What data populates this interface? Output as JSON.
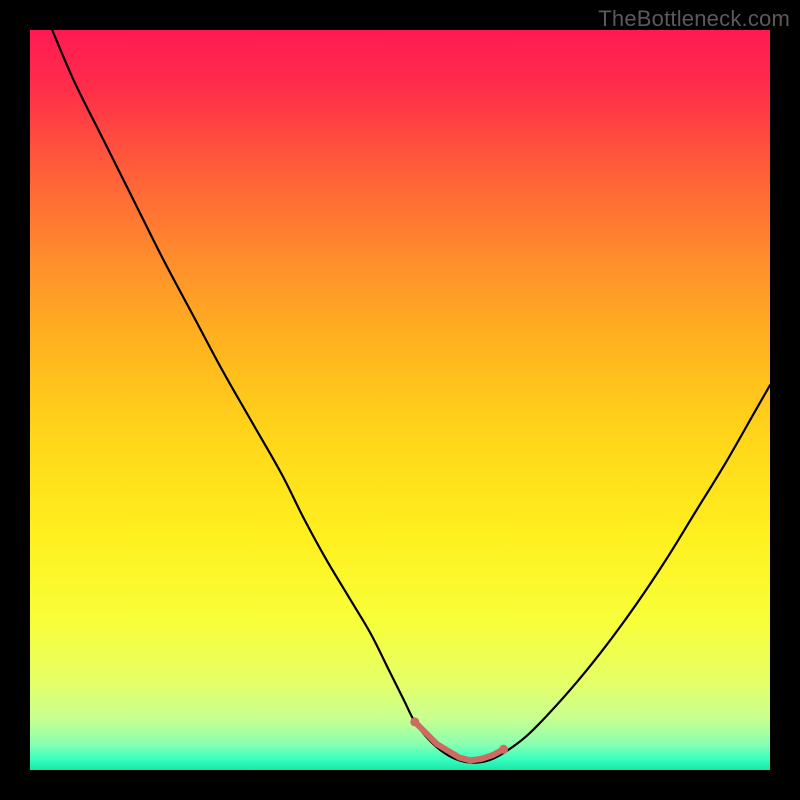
{
  "watermark": "TheBottleneck.com",
  "colors": {
    "page_bg": "#000000",
    "curve": "#000000",
    "marker": "#cf6a62"
  },
  "gradient_stops": [
    {
      "offset": 0.0,
      "color": "#ff1a53"
    },
    {
      "offset": 0.08,
      "color": "#ff2e4a"
    },
    {
      "offset": 0.18,
      "color": "#ff5a3a"
    },
    {
      "offset": 0.3,
      "color": "#ff8a2e"
    },
    {
      "offset": 0.42,
      "color": "#ffb21f"
    },
    {
      "offset": 0.55,
      "color": "#ffd61a"
    },
    {
      "offset": 0.68,
      "color": "#ffef1e"
    },
    {
      "offset": 0.8,
      "color": "#f8ff3a"
    },
    {
      "offset": 0.88,
      "color": "#e6ff66"
    },
    {
      "offset": 0.93,
      "color": "#c8ff90"
    },
    {
      "offset": 0.965,
      "color": "#8affb0"
    },
    {
      "offset": 0.985,
      "color": "#3affc0"
    },
    {
      "offset": 1.0,
      "color": "#18e6a8"
    }
  ],
  "chart_data": {
    "type": "line",
    "title": "",
    "xlabel": "",
    "ylabel": "",
    "xlim": [
      0,
      100
    ],
    "ylim": [
      0,
      100
    ],
    "series": [
      {
        "name": "bottleneck-curve",
        "x": [
          3,
          6,
          10,
          14,
          18,
          22,
          26,
          30,
          34,
          37,
          40,
          43,
          46,
          48.5,
          50.5,
          52,
          54,
          56,
          58,
          60,
          62,
          64,
          67,
          70,
          74,
          78,
          82,
          86,
          90,
          94,
          98,
          100
        ],
        "y": [
          100,
          93,
          85,
          77,
          69,
          61.5,
          54,
          47,
          40,
          34,
          28.5,
          23.5,
          18.5,
          13.5,
          9.5,
          6.5,
          4.0,
          2.3,
          1.3,
          1.0,
          1.3,
          2.3,
          4.5,
          7.5,
          12.0,
          17.0,
          22.5,
          28.5,
          35.0,
          41.5,
          48.5,
          52.0
        ]
      }
    ],
    "marker": {
      "name": "optimal-range",
      "color": "#cf6a62",
      "stroke_width": 6,
      "dot_radius": 4.5,
      "x": [
        52,
        53.5,
        55,
        56.5,
        58,
        59.5,
        61,
        62.5,
        64
      ],
      "y": [
        6.5,
        5.0,
        3.5,
        2.6,
        1.7,
        1.3,
        1.5,
        2.0,
        2.8
      ]
    }
  }
}
